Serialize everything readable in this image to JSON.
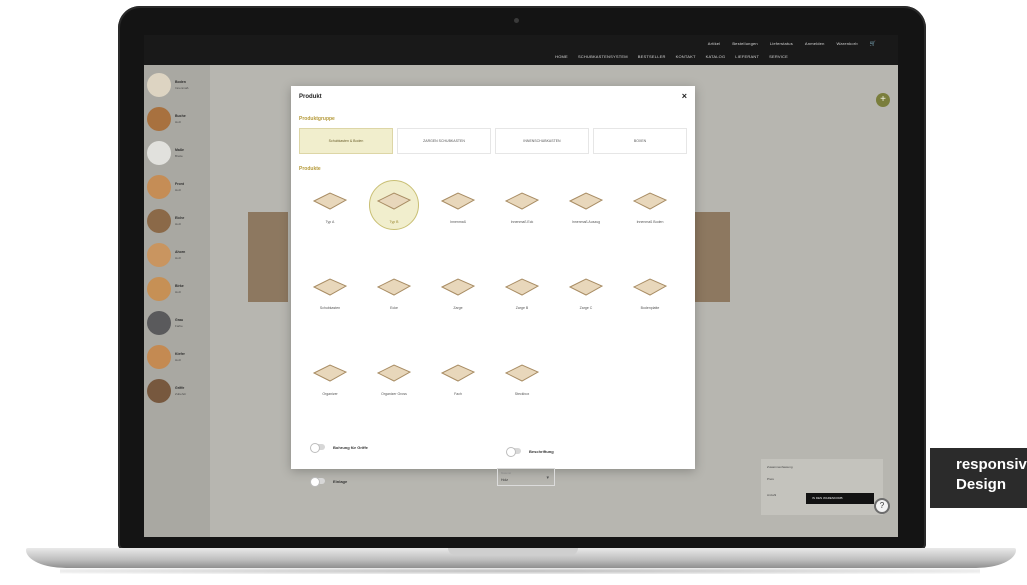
{
  "app": {
    "topnav_primary": [
      "Artikel",
      "Bestellungen",
      "Lieferstatus",
      "Anmelden",
      "Warenkorb"
    ],
    "topnav_secondary": [
      "HOME",
      "SCHUBKASTENSYSTEM",
      "BESTSELLER",
      "KONTAKT",
      "KATALOG",
      "LIEFERANT",
      "SERVICE"
    ]
  },
  "sidebar": {
    "items": [
      {
        "title": "Boden",
        "sub": "Innenmaß",
        "color": "#ddd4c2"
      },
      {
        "title": "Buche",
        "sub": "Holz",
        "color": "#a8713f"
      },
      {
        "title": "Maße",
        "sub": "Breite",
        "color": "#e1e1dd"
      },
      {
        "title": "Front",
        "sub": "Holz",
        "color": "#c58d56"
      },
      {
        "title": "Eiche",
        "sub": "Holz",
        "color": "#8b6948"
      },
      {
        "title": "Ahorn",
        "sub": "Holz",
        "color": "#c99560"
      },
      {
        "title": "Birke",
        "sub": "Holz",
        "color": "#c69055"
      },
      {
        "title": "Grau",
        "sub": "Farbe",
        "color": "#5a5a5c"
      },
      {
        "title": "Kiefer",
        "sub": "Holz",
        "color": "#c48a52"
      },
      {
        "title": "Griffe",
        "sub": "Zubehör",
        "color": "#77583e"
      }
    ]
  },
  "modal": {
    "title": "Produkt",
    "close_glyph": "×",
    "group_heading": "Produktgruppe",
    "groups": [
      "Schubkasten & Boden",
      "ZARGEN SCHUBKASTEN",
      "INNENSCHUBKASTEN",
      "BOXEN"
    ],
    "products_heading": "Produkte",
    "products": [
      "Typ A",
      "Typ B",
      "Innenmaß",
      "Innenmaß Eck",
      "Innenmaß Auszug",
      "Innenmaß Boden",
      "Schubkasten",
      "Ecke",
      "Zarge",
      "Zarge B",
      "Zarge C",
      "Bodenplatte",
      "Organizer",
      "Organizer Gross",
      "Fach",
      "Steckbox"
    ],
    "toggles": [
      "Bohrung für Griffe",
      "Beschriftung",
      "Einlage"
    ],
    "select": {
      "label": "Material",
      "value": "Holz",
      "caret": "▾"
    }
  },
  "order": {
    "title": "Zusammenfassung",
    "price_label": "Preis",
    "qty_label": "Anzahl",
    "button": "IN DEN WARENKORB"
  },
  "fab": {
    "add": "+",
    "help": "?"
  },
  "badge": {
    "line1": "responsive",
    "line2": "Design"
  }
}
